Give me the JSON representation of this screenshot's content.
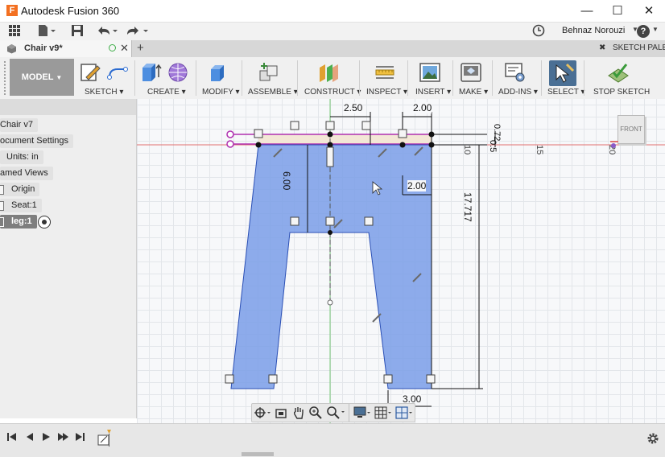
{
  "app": {
    "title": "Autodesk Fusion 360",
    "logo": "F",
    "minimize": "—",
    "maximize": "☐",
    "close": "✕"
  },
  "qat": {
    "user": "Behnaz Norouzi",
    "help": "?"
  },
  "tab": {
    "name": "Chair v9*",
    "add": "+",
    "palette_label": "SKETCH PALETTE"
  },
  "ribbon": {
    "mode": "MODEL",
    "groups": [
      "SKETCH",
      "CREATE",
      "MODIFY",
      "ASSEMBLE",
      "CONSTRUCT",
      "INSPECT",
      "INSERT",
      "MAKE",
      "ADD-INS",
      "SELECT",
      "STOP SKETCH"
    ]
  },
  "browser": {
    "nodes": [
      "Chair v7",
      "ocument Settings",
      "Units: in",
      "amed Views",
      "Origin",
      "Seat:1",
      "leg:1"
    ]
  },
  "sketch": {
    "dims": {
      "top_left": "2.50",
      "top_right": "2.00",
      "mid_right": "2.00",
      "height_inner": "6.00",
      "height_total": "17.717",
      "bottom": "3.00",
      "small_a": "0.72",
      "small_b": "0.5"
    },
    "ruler": [
      "10",
      "15",
      "20"
    ],
    "viewcube": "FRONT",
    "colors": {
      "fill": "#7a9de8",
      "stroke": "#2a4fb5",
      "axis_red": "#e06666",
      "axis_green": "#66cc66",
      "constraint": "#b030b0"
    }
  },
  "timeline": {
    "buttons": [
      "⏮",
      "◀",
      "▶",
      "▶▶",
      "⏭"
    ]
  }
}
